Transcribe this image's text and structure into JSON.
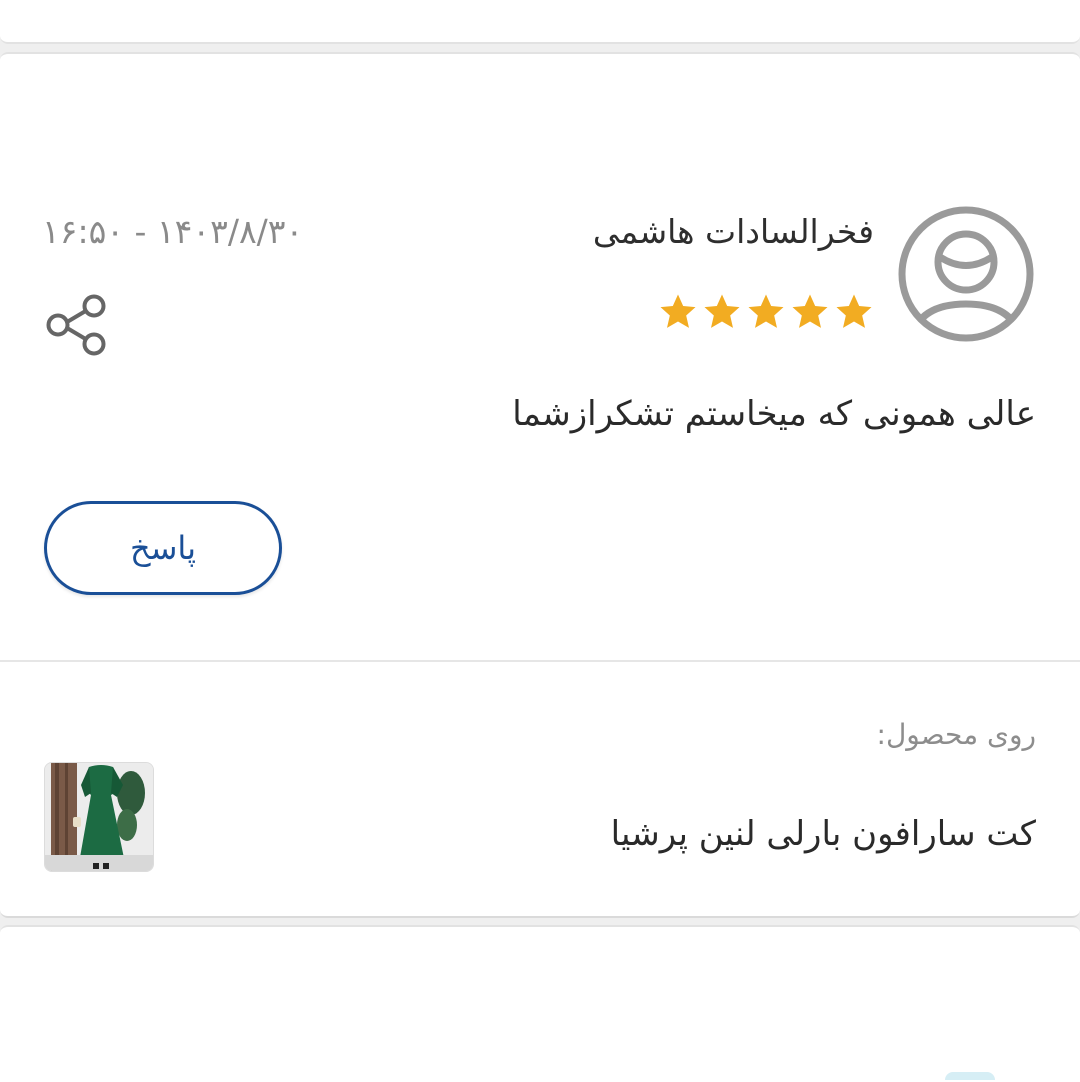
{
  "review": {
    "username": "فخرالسادات هاشمی",
    "date": "۱۴۰۳/۸/۳۰ - ۱۶:۵۰",
    "rating": 5,
    "rating_max": 5,
    "comment": "عالی همونی که میخاستم تشکرازشما",
    "reply_label": "پاسخ",
    "avatar_icon": "user-avatar-icon",
    "share_icon": "share-icon",
    "star_icon": "star-icon"
  },
  "product": {
    "on_product_label": "روی محصول:",
    "name": "کت سارافون بارلی لنین پرشیا",
    "thumbnail": "product-thumbnail"
  },
  "colors": {
    "star": "#f2ac22",
    "primary": "#1a4f97",
    "icon_gray": "#9a9a9a"
  }
}
